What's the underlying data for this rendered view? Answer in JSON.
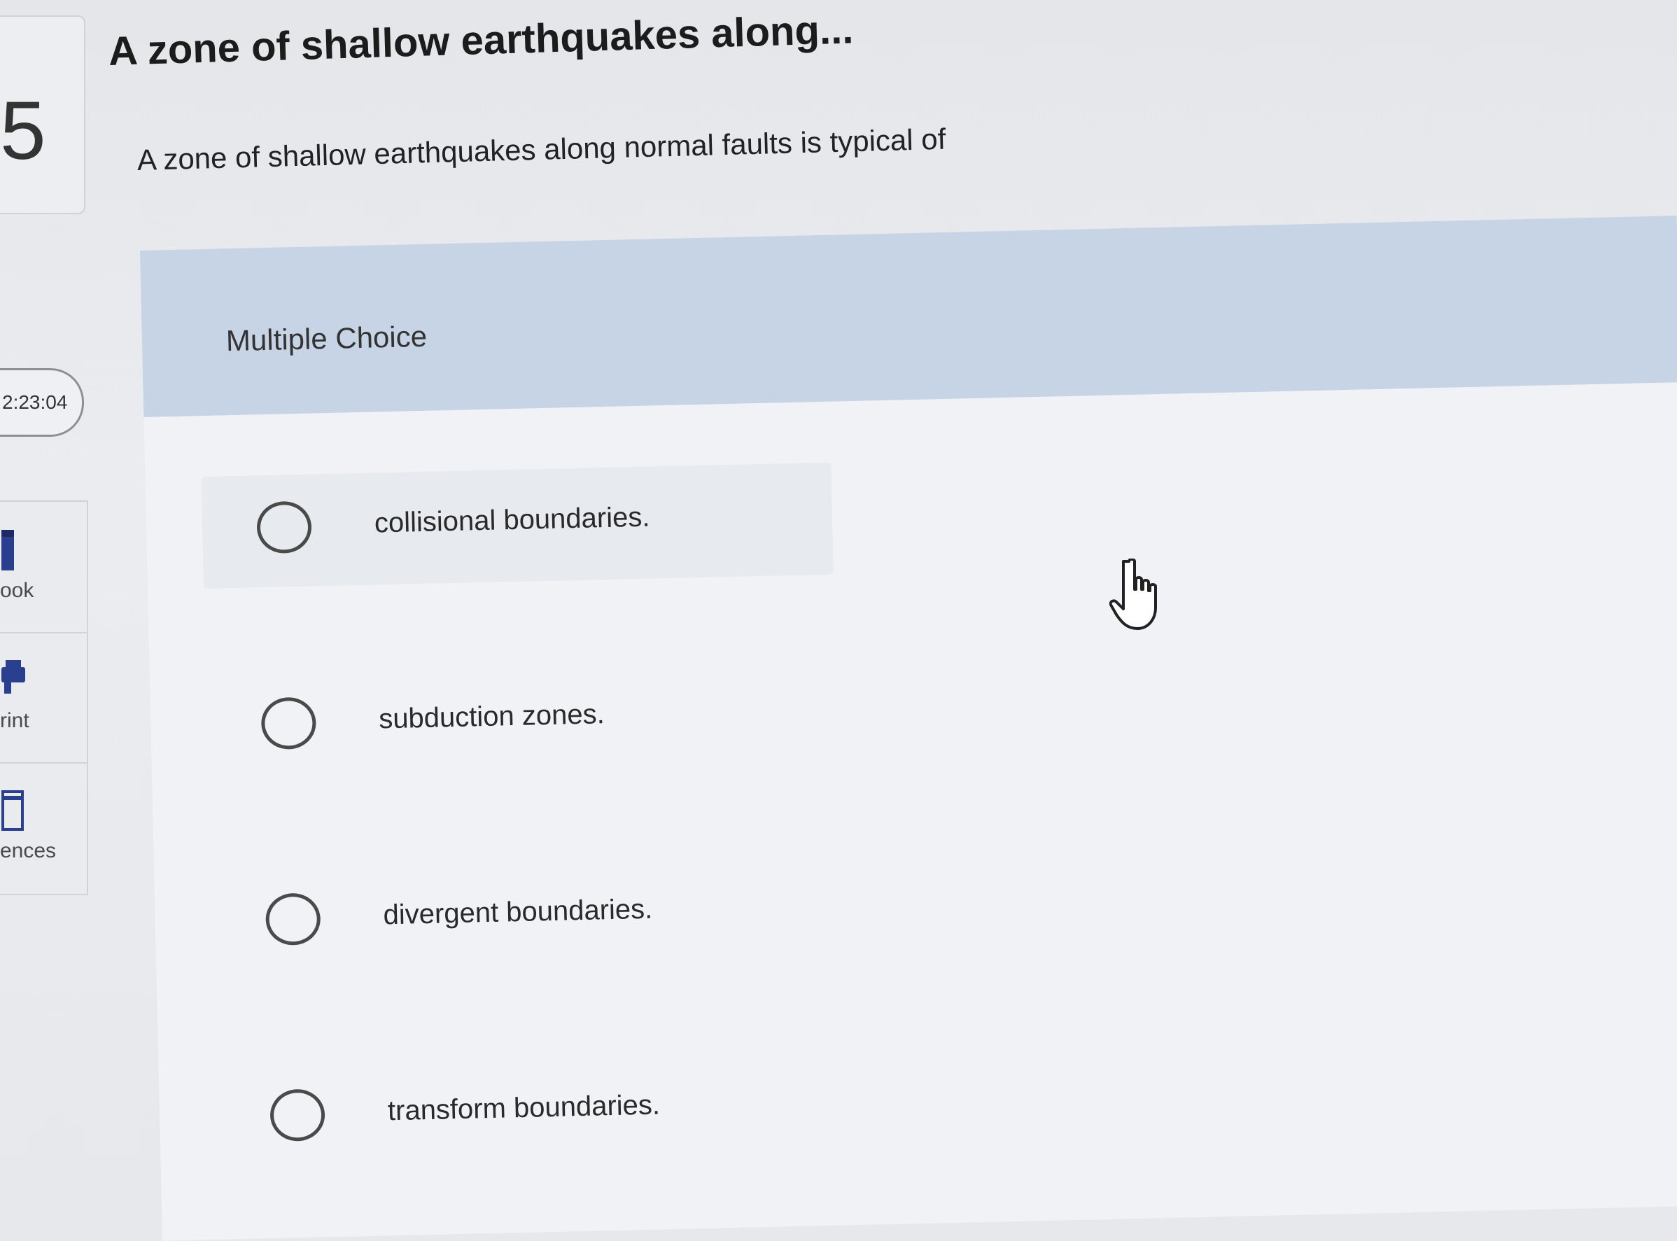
{
  "question": {
    "number": "5",
    "title": "A zone of shallow earthquakes along...",
    "text": "A zone of shallow earthquakes along normal faults is typical of",
    "type_label": "Multiple Choice"
  },
  "timer": {
    "value": "2:23:04"
  },
  "tools": [
    {
      "label": "ook",
      "icon": "book-icon"
    },
    {
      "label": "rint",
      "icon": "print-icon"
    },
    {
      "label": "ences",
      "icon": "references-icon"
    }
  ],
  "answers": [
    {
      "label": "collisional boundaries."
    },
    {
      "label": "subduction zones."
    },
    {
      "label": "divergent boundaries."
    },
    {
      "label": "transform boundaries."
    }
  ],
  "cursor": "hand-pointer-icon"
}
